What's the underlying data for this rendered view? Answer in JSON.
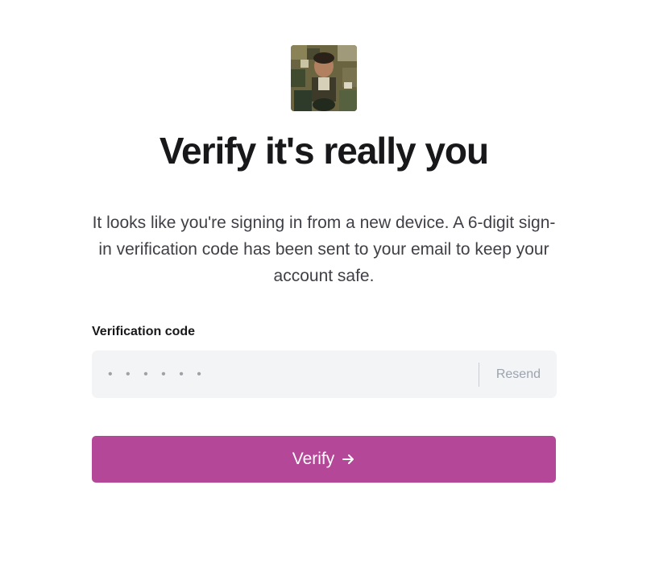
{
  "logo": {
    "icon": "avatar-logo-image"
  },
  "title": "Verify it's really you",
  "description": "It looks like you're signing in from a new device. A 6-digit sign-in verification code has been sent to your email to keep your account safe.",
  "form": {
    "label": "Verification code",
    "placeholder": "• • • • • •",
    "value": "",
    "resend_label": "Resend",
    "verify_label": "Verify",
    "verify_icon": "arrow-right-icon"
  },
  "colors": {
    "accent": "#b44797",
    "field_bg": "#f3f4f6",
    "title": "#18181b",
    "muted": "#9ca3af"
  }
}
